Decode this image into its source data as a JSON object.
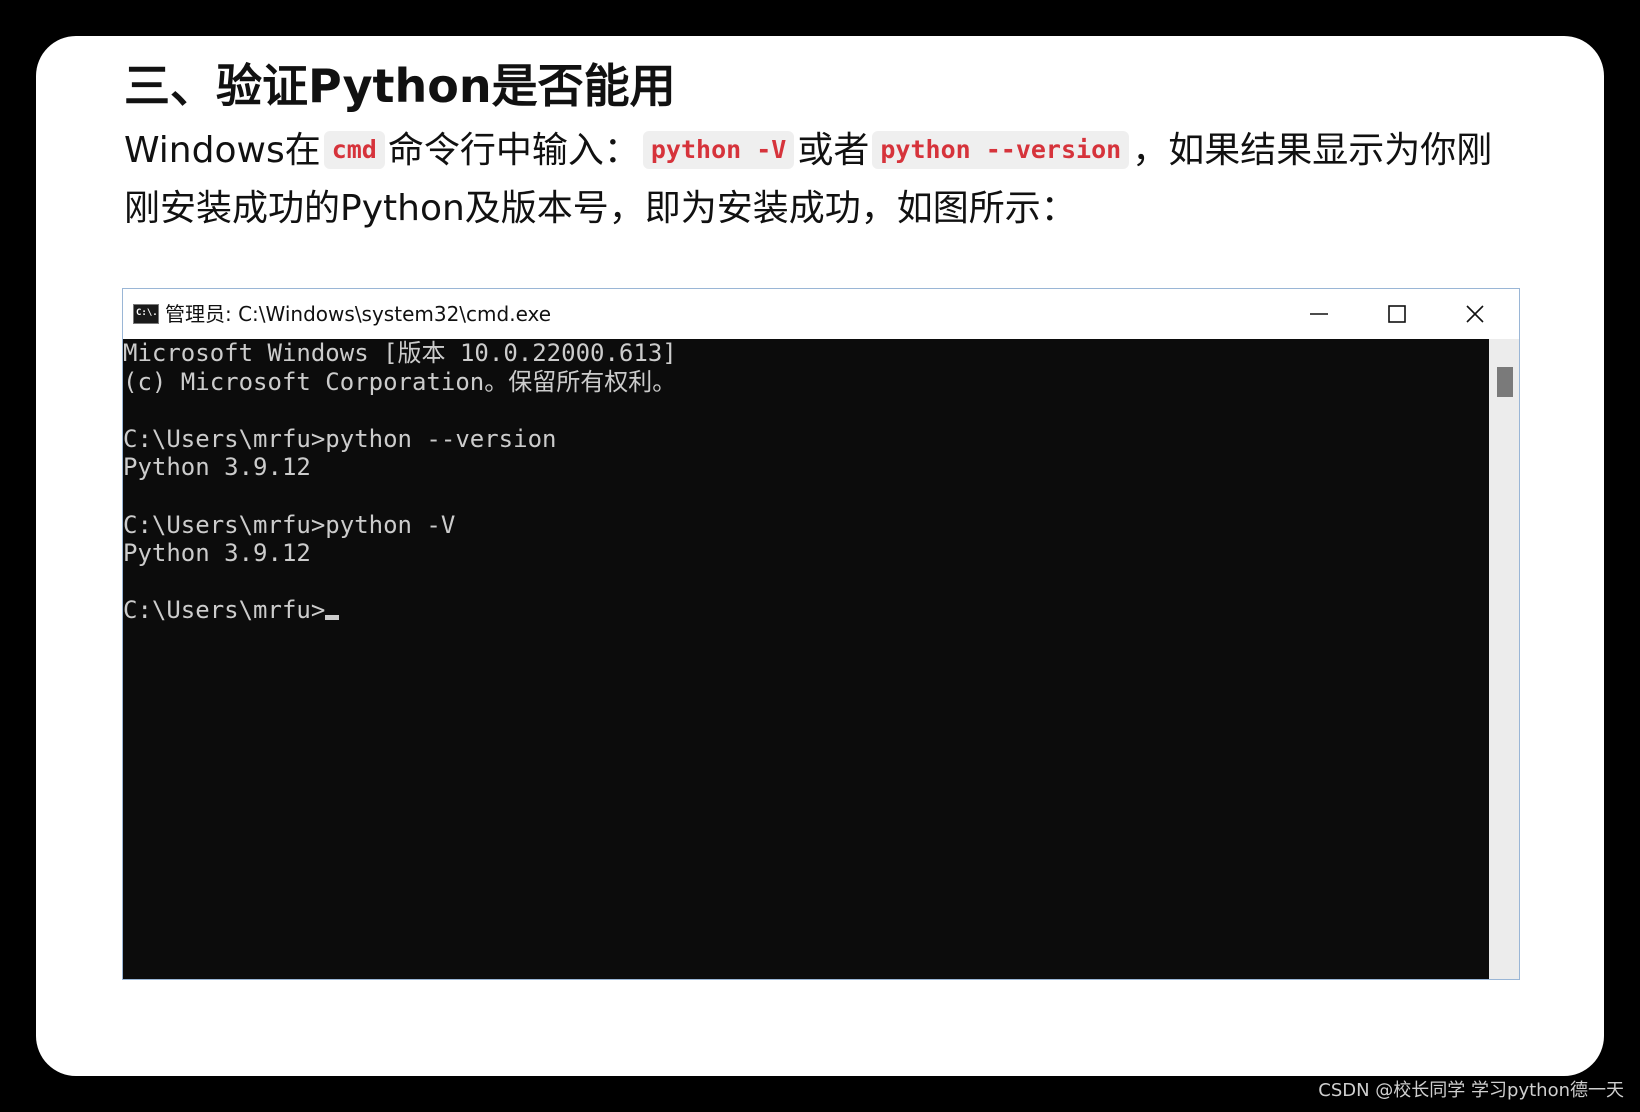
{
  "heading": "三、验证Python是否能用",
  "paragraph": {
    "seg1": "Windows在",
    "code1": "cmd",
    "seg2": "命令行中输入：",
    "code2": "python -V",
    "seg3": "或者",
    "code3": "python --version",
    "seg4": "，如果结果显示为你刚",
    "line2": "刚安装成功的Python及版本号，即为安装成功，如图所示："
  },
  "window": {
    "icon_text": "C:\\.",
    "title": "管理员: C:\\Windows\\system32\\cmd.exe",
    "icons": {
      "app": "cmd-icon",
      "minimize": "minimize-icon",
      "maximize": "maximize-icon",
      "close": "close-icon"
    }
  },
  "console": {
    "lines": [
      "Microsoft Windows [版本 10.0.22000.613]",
      "(c) Microsoft Corporation。保留所有权利。",
      "",
      "C:\\Users\\mrfu>python --version",
      "Python 3.9.12",
      "",
      "C:\\Users\\mrfu>python -V",
      "Python 3.9.12",
      "",
      "C:\\Users\\mrfu>"
    ]
  },
  "watermark": "CSDN @校长同学 学习python德一天",
  "colors": {
    "code_text": "#d6333b",
    "code_bg": "#efefef",
    "console_bg": "#0c0c0c",
    "console_text": "#cccccc"
  }
}
